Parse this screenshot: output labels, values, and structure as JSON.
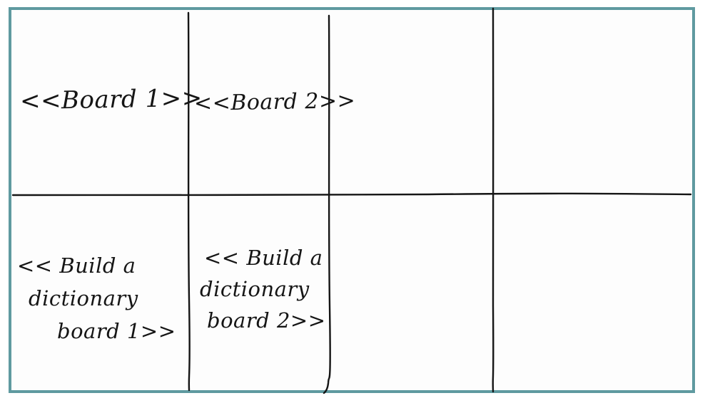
{
  "cells": {
    "board_1": "<<Board 1>>",
    "board_2": "<<Board 2>>",
    "dictionary_board_1": [
      "<< Build a",
      "dictionary",
      "board 1>>"
    ],
    "dictionary_board_2": [
      "<< Build a",
      "dictionary",
      "board 2>>"
    ]
  },
  "colors": {
    "frame_border": "#5f9aa0",
    "ink": "#151515",
    "paper": "#fdfdfd"
  }
}
